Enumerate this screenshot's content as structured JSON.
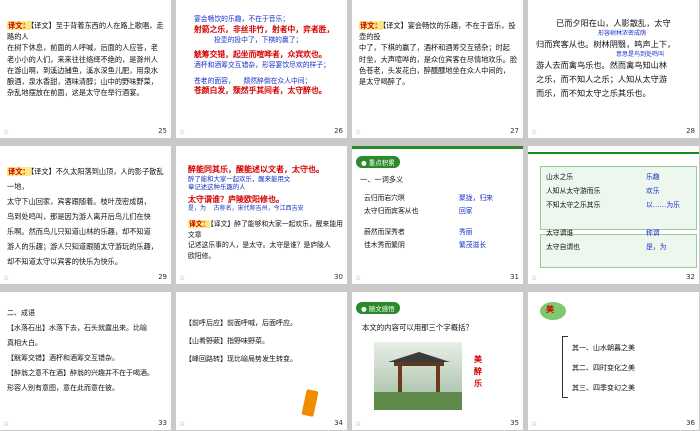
{
  "slides": [
    {
      "num": "25",
      "lines": [
        "【译文】至于背着东西的人在路上歌唱，走路的人",
        "在树下休息，前面的人呼喊，后面的人应答，老",
        "老小小的人们，来来往往络绎不绝的，是滁州人",
        "在游山啊，到溪边捕鱼，溪水深鱼儿肥，用泉水",
        "酿酒，泉水香甜，酒味清醇；山中的野味野菜，",
        "杂乱地摆放在前面，这是太守在举行酒宴。"
      ]
    },
    {
      "num": "26",
      "lines": [
        "宴会畅饮的乐趣，不在于音乐；",
        "射箭之乐，非丝非竹，射者中，弈者胜，",
        "投壶的投中了，下棋的赢了；",
        "觥筹交错，起坐而喧哗者，众宾欢也。",
        "酒杯和酒筹交互错杂，形容宴饮尽欢的样子；",
        "苍老的面容，",
        "颓然醉倒在众人中间；",
        "苍颜白发，颓然乎其间者，太守醉也。"
      ]
    },
    {
      "num": "27",
      "lines": [
        "【译文】宴会畅饮的乐趣，不在于音乐，投壶的投",
        "中了，下棋的赢了，酒杯和酒筹交互错杂；时起",
        "时坐，大声喧哗的，是众位宾客在尽情地欢乐。脸",
        "色苍老，头发花白，醉醺醺地坐在众人中间的，",
        "是太守喝醉了。"
      ]
    },
    {
      "num": "28",
      "lines": [
        "已而夕阳在山，人影散乱，太守",
        "形容树林浓密成荫",
        "归而宾客从也。树林阴翳，鸣声上下，",
        "意思是鸟到处鸣叫",
        "游人去而禽鸟乐也。然而禽鸟知山林",
        "之乐，而不知人之乐；人知从太守游",
        "而乐，而不知太守之乐其乐也。"
      ]
    },
    {
      "num": "29",
      "lines": [
        "【译文】不久太阳落到山顶，人的影子散乱一地，",
        "太守下山回家，宾客跟随着。枝叶茂密成荫，",
        "鸟到处鸣叫，那是因为游人离开后鸟儿们在快",
        "乐啊。然而鸟儿只知道山林的乐趣，却不知道",
        "游人的乐趣；游人只知道跟随太守游玩的乐趣，",
        "却不知道太守以宾客的快乐为快乐。"
      ]
    },
    {
      "num": "30",
      "lines": [
        "醉能同其乐，醒能述以文者，太守也。",
        "醉了能和大家一起欢乐，醒来能用文",
        "章记述这种乐趣的人",
        "太守谓谁？庐陵欧阳修也。",
        "是，为",
        "古称名，宋代称吉州，今江西吉安",
        "【译文】醉了能够和大家一起欢乐，醒来能用文章",
        "记述这乐事的人，是太守。太守是谁？是庐陵人",
        "欧阳修。"
      ]
    },
    {
      "num": "31",
      "head": "重点积累",
      "sub": "一、一词多义",
      "rows": [
        [
          "云归而岩穴暝",
          "聚拢，归来"
        ],
        [
          "太守归而宾客从也",
          "回家"
        ],
        [
          "蔚然而深秀者",
          "秀丽"
        ],
        [
          "佳木秀而繁阴",
          "繁茂滋长"
        ]
      ]
    },
    {
      "num": "32",
      "rows": [
        [
          "山水之乐",
          "乐趣"
        ],
        [
          "人知从太守游而乐",
          "欢乐"
        ],
        [
          "不知太守之乐其乐",
          "以……为乐"
        ],
        [
          "太守谓谁",
          "称谓"
        ],
        [
          "太守自谓也",
          "是，为"
        ]
      ]
    },
    {
      "num": "33",
      "lines": [
        "二、成语",
        "【水落石出】水落下去，石头就露出来。比喻",
        "真相大白。",
        "【觥筹交错】酒杯和酒筹交互错杂。",
        "【醉翁之意不在酒】醉翁的兴趣并不在于喝酒。",
        "形容人别有意图，意在此而意在彼。"
      ]
    },
    {
      "num": "34",
      "lines": [
        "【前呼后应】前面呼喊，后面呼应。",
        "【山肴野蔌】指野味野菜。",
        "【峰回路转】现比喻局势发生转变。"
      ]
    },
    {
      "num": "35",
      "head": "随文感悟",
      "question": "本文的内容可以用那三个字概括？",
      "chars": [
        "美",
        "醉",
        "乐"
      ]
    },
    {
      "num": "36",
      "title": "美",
      "items": [
        "其一、山水朝暮之美",
        "其二、四时变化之美",
        "其三、四季变幻之美"
      ]
    }
  ],
  "colors": {
    "red": "#d40000",
    "blue": "#1530c8",
    "green": "#2a8a2a",
    "tagBg": "#ffe680",
    "slideBg": "#ffffff",
    "pageBg": "#c9c9c9"
  }
}
